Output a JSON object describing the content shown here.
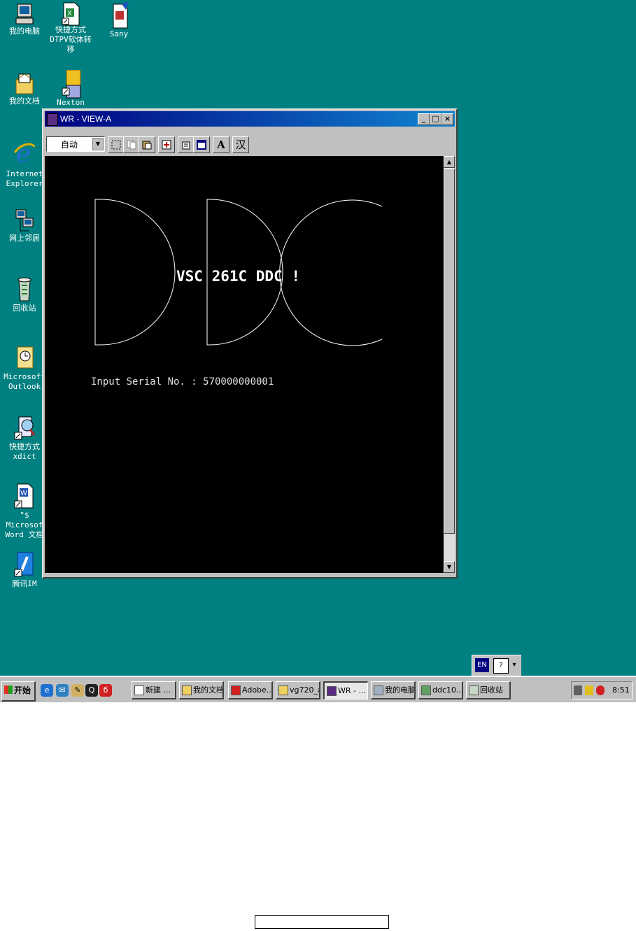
{
  "desktop_icons": [
    {
      "label": "我的电脑",
      "icon": "my-computer-icon"
    },
    {
      "label": "快捷方式\nDTPV软体转移",
      "icon": "excel-shortcut-icon"
    },
    {
      "label": "Sany",
      "icon": "document-pen-icon"
    },
    {
      "label": "我的文档",
      "icon": "my-documents-icon"
    },
    {
      "label": "Nexton",
      "icon": "folder-shortcut-icon"
    },
    {
      "label": "Internet\nExplorer",
      "icon": "internet-explorer-icon"
    },
    {
      "label": "网上邻居",
      "icon": "network-neighborhood-icon"
    },
    {
      "label": "回收站",
      "icon": "recycle-bin-icon"
    },
    {
      "label": "Microsoft\nOutlook",
      "icon": "outlook-icon"
    },
    {
      "label": "快捷方式\nxdict",
      "icon": "xdict-shortcut-icon"
    },
    {
      "label": "\"$ Microsof\nWord 文档",
      "icon": "word-document-icon"
    },
    {
      "label": "腾讯IM",
      "icon": "tencent-im-icon"
    }
  ],
  "window": {
    "title": "WR - VIEW-A",
    "controls": {
      "minimize": "_",
      "maximize": "□",
      "close": "×"
    },
    "toolbar": {
      "mode_value": "自动",
      "tools": [
        "mark-icon",
        "copy-icon",
        "paste-icon",
        "fullscreen-icon",
        "properties-icon",
        "background-icon",
        "A",
        "汉"
      ]
    },
    "console": {
      "logo_letters": [
        "D",
        "D",
        "C"
      ],
      "banner": "VSC 261C DDC !",
      "serial_line": "Input Serial No. : 570000000001"
    }
  },
  "ime_bar": {
    "lang": "EN",
    "help": "?",
    "menu": "▾"
  },
  "taskbar": {
    "start_label": "开始",
    "quick_launch": [
      "ie-icon",
      "outlook-express-icon",
      "desktop-icon",
      "qq-icon",
      "netease-icon"
    ],
    "tasks": [
      {
        "label": "新建 ...",
        "active": false
      },
      {
        "label": "我的文档",
        "active": false
      },
      {
        "label": "Adobe...",
        "active": false
      },
      {
        "label": "vg720_a",
        "active": false
      },
      {
        "label": "WR - ...",
        "active": true
      },
      {
        "label": "我的电脑",
        "active": false
      },
      {
        "label": "ddc10...",
        "active": false
      },
      {
        "label": "回收站",
        "active": false
      }
    ],
    "clock": "8:51"
  }
}
